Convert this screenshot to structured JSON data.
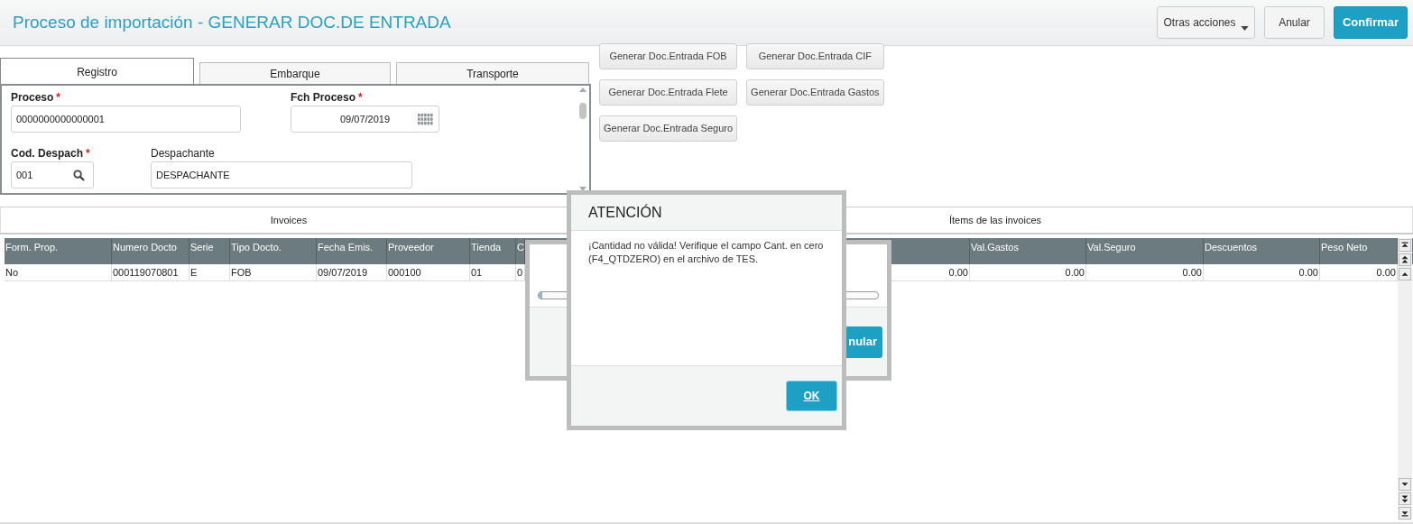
{
  "header": {
    "title": "Proceso de importación - GENERAR DOC.DE ENTRADA",
    "buttons": [
      {
        "label": "Otras acciones",
        "kind": "dropdown"
      },
      {
        "label": "Anular",
        "kind": "default"
      },
      {
        "label": "Confirmar",
        "kind": "primary"
      }
    ]
  },
  "form_tabs": [
    {
      "label": "Registro",
      "selected": true
    },
    {
      "label": "Embarque",
      "selected": false
    },
    {
      "label": "Transporte",
      "selected": false
    }
  ],
  "fields": [
    {
      "label": "Proceso",
      "marker": "*",
      "value": "0000000000000001",
      "kind": "text"
    },
    {
      "label": "Fch Proceso",
      "marker": "*",
      "value": "09/07/2019",
      "kind": "date"
    },
    {
      "label": "Cod. Despach",
      "marker": "*",
      "value": "001",
      "kind": "lookup"
    },
    {
      "label": "Despachante",
      "value": "DESPACHANTE",
      "kind": "text"
    }
  ],
  "action_buttons": [
    "Generar Doc.Entrada FOB",
    "Generar Doc.Entrada CIF",
    "Generar Doc.Entrada Flete",
    "Generar Doc.Entrada Gastos",
    "Generar Doc.Entrada Seguro"
  ],
  "grid_tabs": [
    "Invoices",
    "Ítems de las invoices"
  ],
  "table": {
    "columns": [
      "Form. Prop.",
      "Numero Docto",
      "Serie",
      "Tipo Docto.",
      "Fecha Emis.",
      "Proveedor",
      "Tienda",
      "C",
      "",
      "",
      "Val.Gastos",
      "Val.Seguro",
      "Descuentos",
      "Peso Neto"
    ],
    "rows": [
      [
        "No",
        "000119070801",
        "E",
        "FOB",
        "09/07/2019",
        "000100",
        "01",
        "0",
        "",
        "0.00",
        "0.00",
        "0.00",
        "0.00",
        "0.00"
      ]
    ]
  },
  "progress_dialog": {
    "level": 0.01,
    "button": "nular"
  },
  "alert": {
    "title": "ATENCIÓN",
    "message": "¡Cantidad no válida! Verifique el campo Cant. en cero (F4_QTDZERO) en el archivo de TES.",
    "button": "OK"
  }
}
